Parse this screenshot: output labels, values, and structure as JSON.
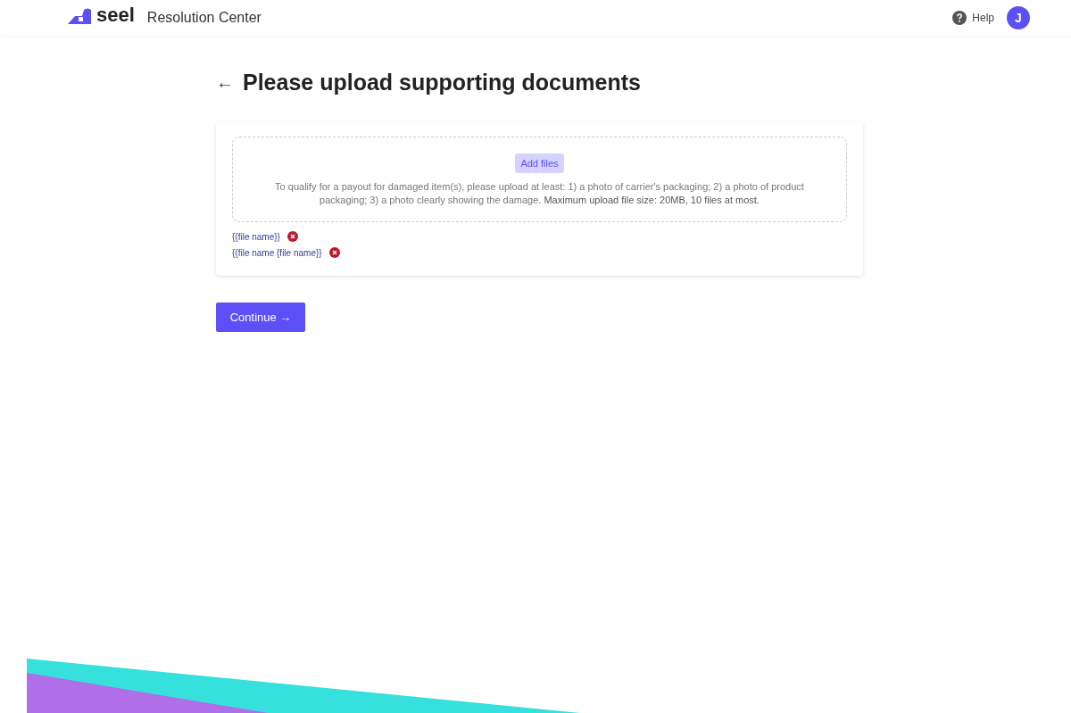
{
  "header": {
    "brand": "seel",
    "title": "Resolution Center",
    "help": "Help",
    "avatar": "J"
  },
  "page": {
    "back": "←",
    "title": "Please upload supporting documents"
  },
  "upload": {
    "button": "Add files",
    "description": "To qualify for a payout for damaged item(s), please upload at least: 1) a photo of carrier's packaging; 2) a photo of product packaging; 3) a photo clearly showing the damage. **Maximum upload file size: 20MB, 10 files at most.**"
  },
  "files": [
    {
      "name": "{{file name}}"
    },
    {
      "name": "{{file name {file name}}"
    }
  ],
  "continue": "Continue →"
}
